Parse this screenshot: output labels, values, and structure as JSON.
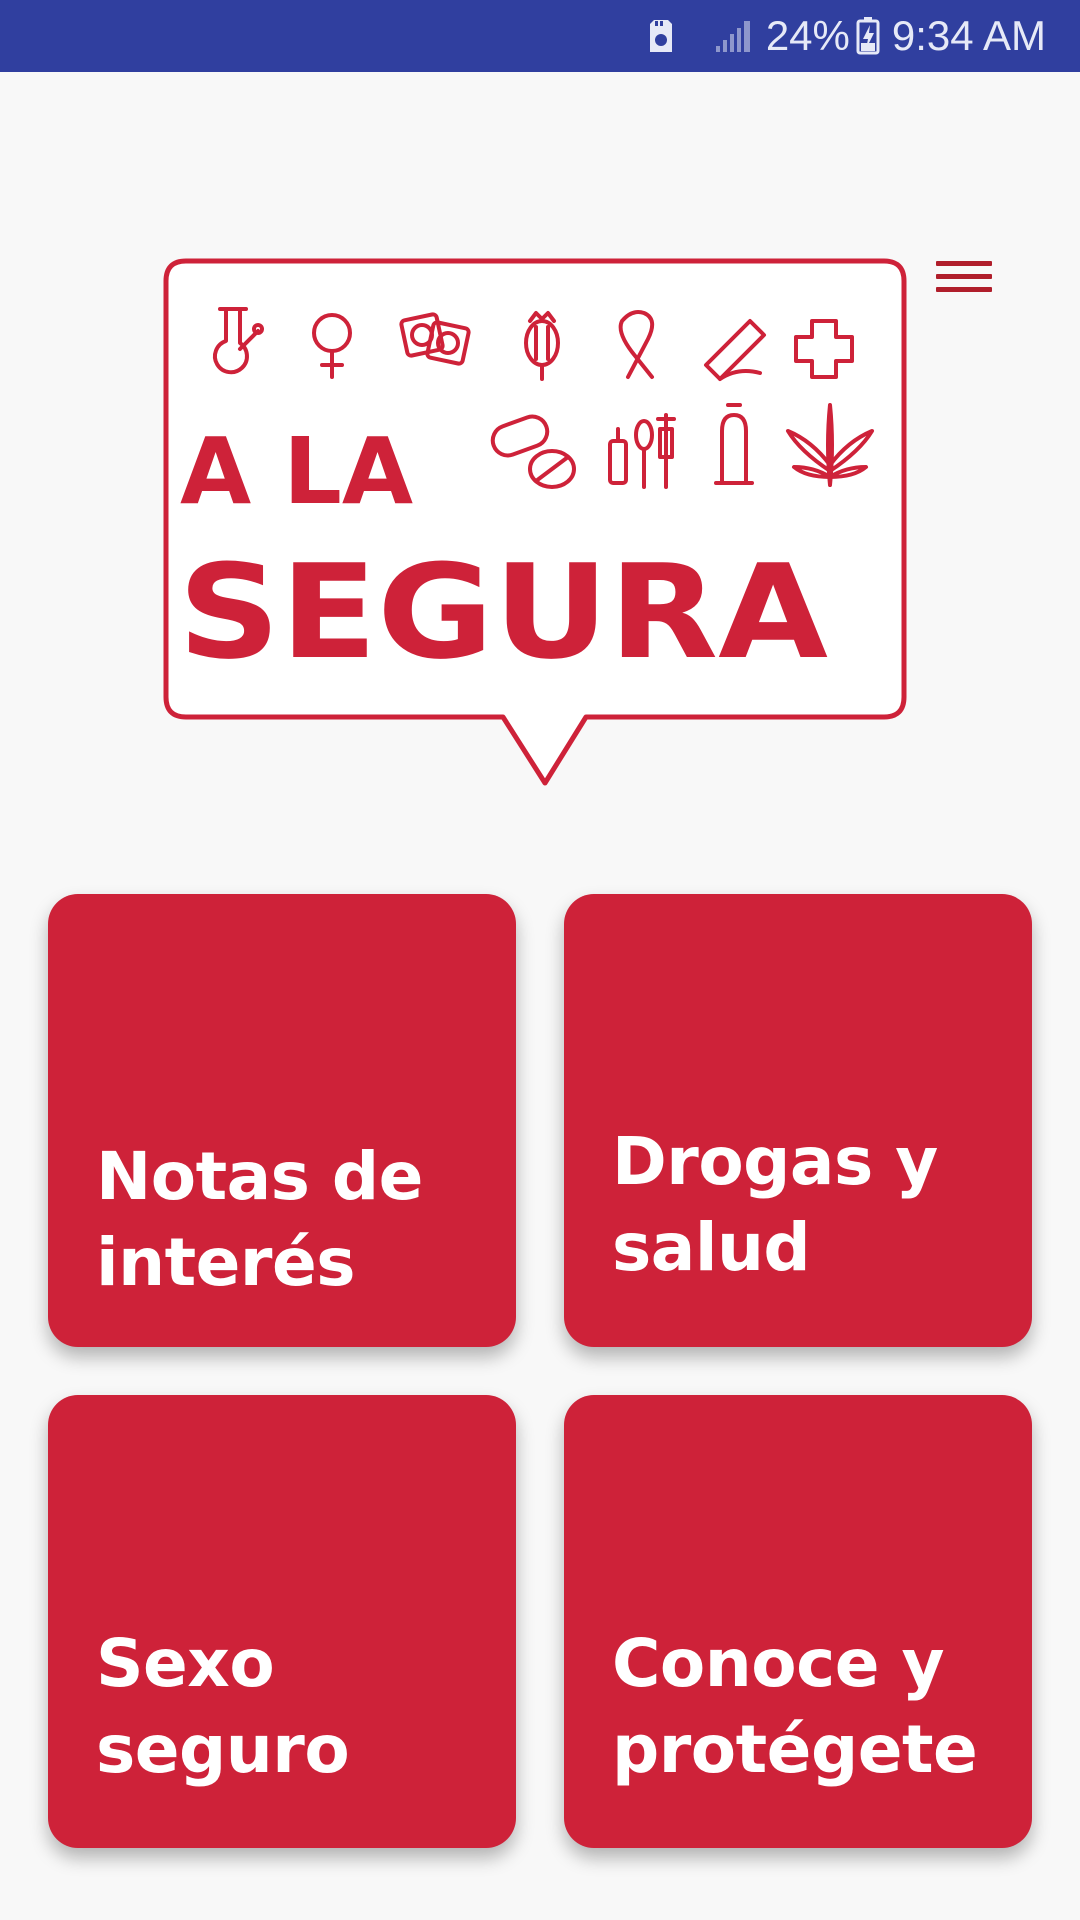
{
  "status_bar": {
    "battery_percent": "24%",
    "time": "9:34 AM",
    "icons": [
      "sd-card-icon",
      "signal-icon",
      "battery-icon"
    ],
    "background_color": "#303f9f"
  },
  "header": {
    "menu_icon": "hamburger-menu-icon",
    "logo": {
      "line1": "A LA",
      "line2": "SEGURA",
      "icons": [
        "bong-icon",
        "female-symbol-icon",
        "condom-wrapper-icon",
        "poppy-icon",
        "awareness-ribbon-icon",
        "rolling-paper-icon",
        "medical-cross-icon",
        "pills-icon",
        "lighter-spoon-syringe-icon",
        "condom-icon",
        "cannabis-leaf-icon"
      ],
      "color": "#ce2239"
    }
  },
  "tiles": [
    {
      "line1": "Notas de",
      "line2": "interés"
    },
    {
      "line1": "Drogas y",
      "line2": "salud"
    },
    {
      "line1": "Sexo",
      "line2": "seguro"
    },
    {
      "line1": "Conoce y",
      "line2": "protégete"
    }
  ],
  "colors": {
    "accent": "#ce2239",
    "page_background": "#f8f8f8"
  }
}
